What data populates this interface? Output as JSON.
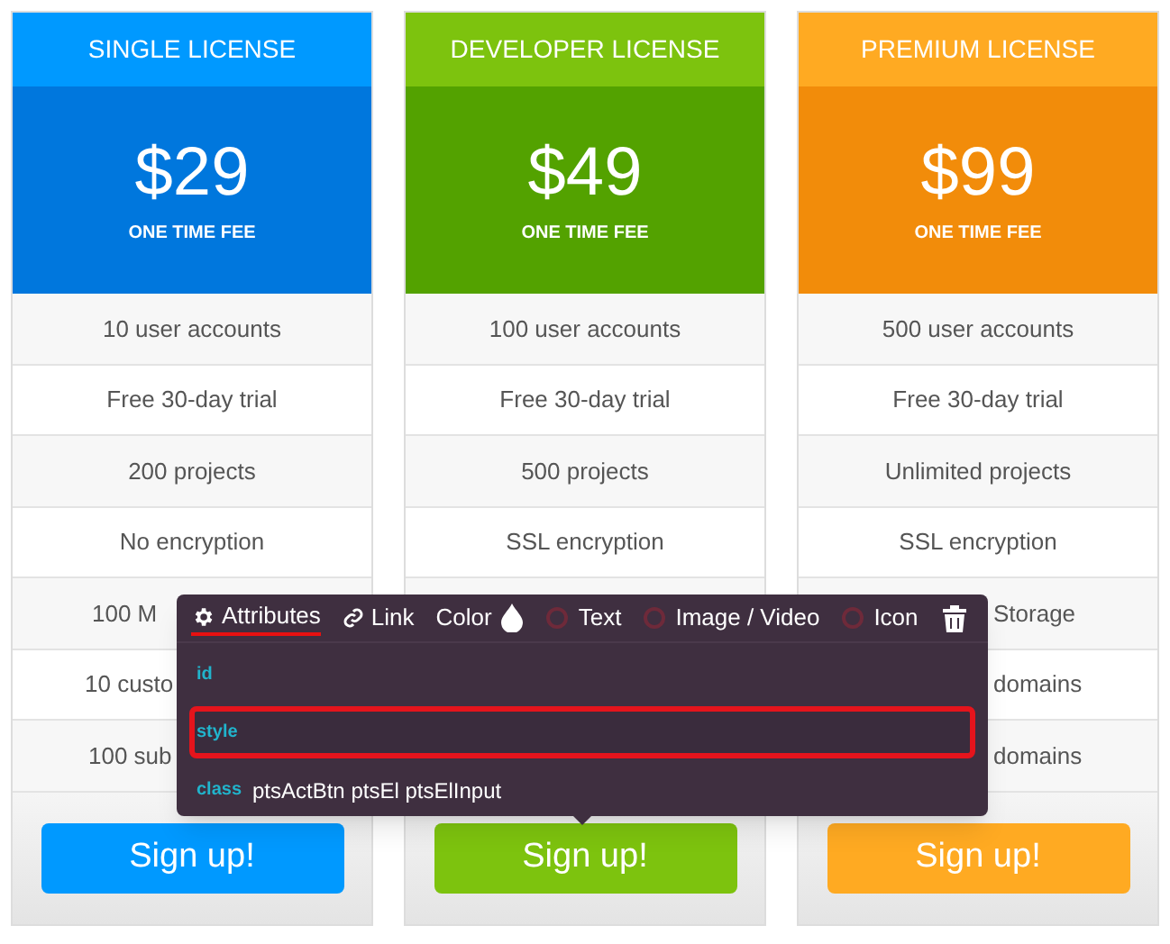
{
  "plans": [
    {
      "title": "SINGLE LICENSE",
      "price": "$29",
      "fee": "ONE TIME FEE",
      "color": "#0099ff",
      "features": [
        {
          "text": "10 user accounts",
          "kind": "full"
        },
        {
          "text": "Free 30-day trial",
          "kind": "full"
        },
        {
          "text": "200 projects",
          "kind": "full"
        },
        {
          "text": "No encryption",
          "kind": "full"
        },
        {
          "text": "100 M",
          "kind": "cut_end"
        },
        {
          "text": "10 custo",
          "kind": "cut_end"
        },
        {
          "text": "100 sub",
          "kind": "cut_end"
        }
      ],
      "button": "Sign up!"
    },
    {
      "title": "DEVELOPER LICENSE",
      "price": "$49",
      "fee": "ONE TIME FEE",
      "color": "#7dc30e",
      "features": [
        {
          "text": "100 user accounts",
          "kind": "full"
        },
        {
          "text": "Free 30-day trial",
          "kind": "full"
        },
        {
          "text": "500 projects",
          "kind": "full"
        },
        {
          "text": "SSL encryption",
          "kind": "full"
        }
      ],
      "button": "Sign up!"
    },
    {
      "title": "PREMIUM LICENSE",
      "price": "$99",
      "fee": "ONE TIME FEE",
      "color": "#ffaa22",
      "features": [
        {
          "text": "500 user accounts",
          "kind": "full"
        },
        {
          "text": "Free 30-day trial",
          "kind": "full"
        },
        {
          "text": "Unlimited projects",
          "kind": "full"
        },
        {
          "text": "SSL encryption",
          "kind": "full"
        },
        {
          "text": "Storage",
          "kind": "cut_start"
        },
        {
          "text": "domains",
          "kind": "cut_start"
        },
        {
          "text": "domains",
          "kind": "cut_start"
        }
      ],
      "button": "Sign up!"
    }
  ],
  "editor": {
    "tabs": [
      {
        "label": "Attributes",
        "kind": "gear",
        "selected": true
      },
      {
        "label": "Link",
        "kind": "link",
        "selected": false
      },
      {
        "label": "Color",
        "kind": "drop",
        "selected": false
      },
      {
        "label": "Text",
        "kind": "radio",
        "selected": false
      },
      {
        "label": "Image / Video",
        "kind": "radio",
        "selected": false
      },
      {
        "label": "Icon",
        "kind": "radio",
        "selected": false
      }
    ],
    "fields": [
      {
        "label": "id",
        "focused": false
      },
      {
        "label": "style",
        "focused": true
      },
      {
        "label": "class",
        "value": "ptsActBtn ptsEl ptsElInput",
        "focused": false
      }
    ]
  }
}
